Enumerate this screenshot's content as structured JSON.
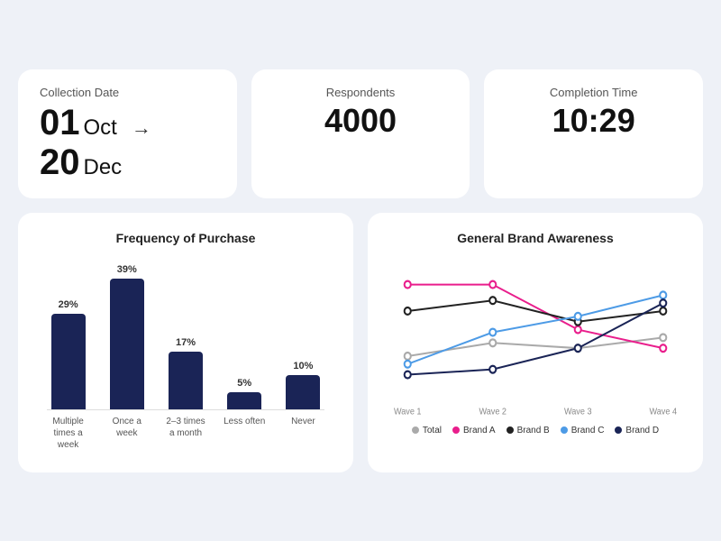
{
  "header": {
    "collection_date_label": "Collection Date",
    "collection_date_value_start": "01",
    "collection_date_start_month": "Oct",
    "collection_date_arrow": "→",
    "collection_date_value_end": "20",
    "collection_date_end_month": "Dec",
    "respondents_label": "Respondents",
    "respondents_value": "4000",
    "completion_time_label": "Completion Time",
    "completion_time_value": "10:29"
  },
  "bar_chart": {
    "title": "Frequency of Purchase",
    "bars": [
      {
        "label": "Multiple\ntimes a\nweek",
        "pct": "29%",
        "height_ratio": 0.73
      },
      {
        "label": "Once a\nweek",
        "pct": "39%",
        "height_ratio": 1.0
      },
      {
        "label": "2–3\ntimes a\nmonth",
        "pct": "17%",
        "height_ratio": 0.44
      },
      {
        "label": "Less\noften",
        "pct": "5%",
        "height_ratio": 0.13
      },
      {
        "label": "Never",
        "pct": "10%",
        "height_ratio": 0.26
      }
    ]
  },
  "line_chart": {
    "title": "General Brand Awareness",
    "x_labels": [
      "Wave 1",
      "Wave 2",
      "Wave 3",
      "Wave 4"
    ],
    "legend": [
      {
        "label": "Total",
        "color": "#888",
        "fill": "#888"
      },
      {
        "label": "Brand A",
        "color": "#e91e8c",
        "fill": "#e91e8c"
      },
      {
        "label": "Brand B",
        "color": "#111",
        "fill": "#111"
      },
      {
        "label": "Brand C",
        "color": "#4d9be6",
        "fill": "#4d9be6"
      },
      {
        "label": "Brand D",
        "color": "#1a2456",
        "fill": "#1a2456"
      }
    ],
    "series": {
      "Total": [
        35,
        40,
        38,
        42
      ],
      "BrandA": [
        62,
        62,
        45,
        38
      ],
      "BrandB": [
        52,
        56,
        48,
        52
      ],
      "BrandC": [
        32,
        44,
        50,
        58
      ],
      "BrandD": [
        28,
        30,
        38,
        55
      ]
    }
  }
}
